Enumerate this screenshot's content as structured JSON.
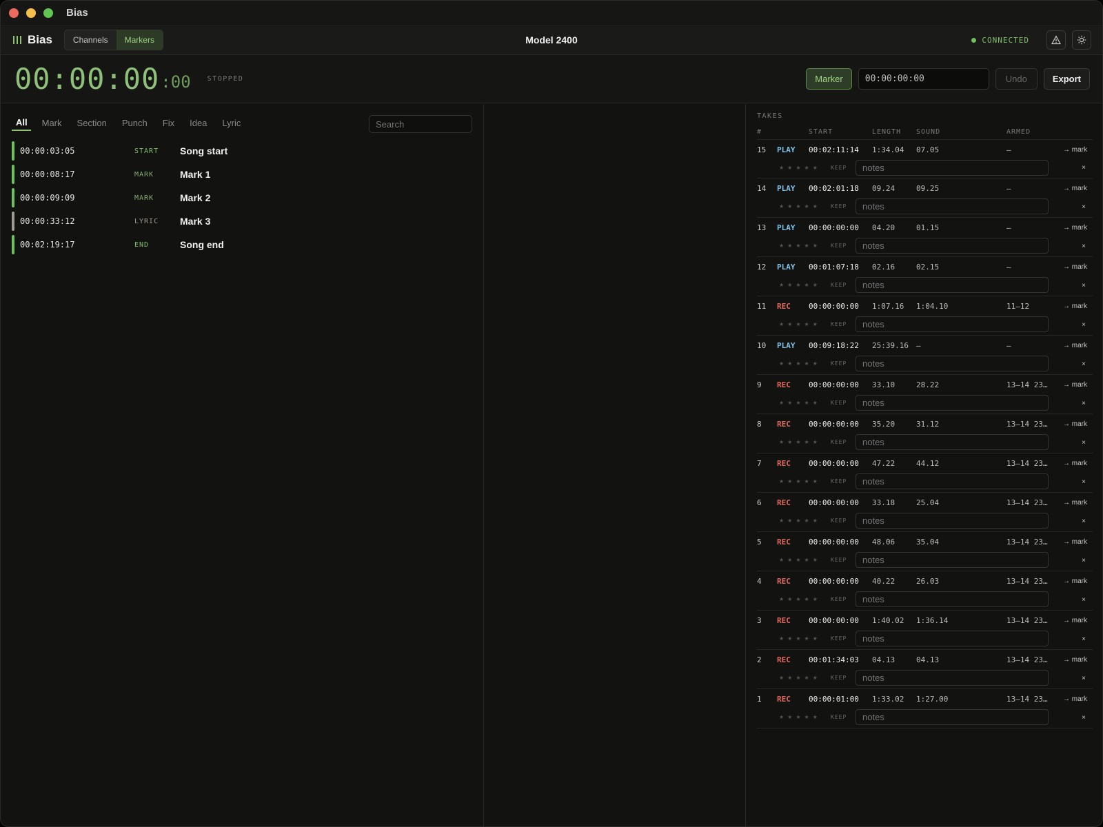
{
  "window": {
    "title": "Bias"
  },
  "app": {
    "logo": "Bias",
    "views": [
      "Channels",
      "Markers"
    ],
    "active_view": "Markers",
    "model": "Model 2400",
    "status": "CONNECTED",
    "icons": [
      "warning-icon",
      "brightness-icon"
    ]
  },
  "transport": {
    "timecode": "00:00:00",
    "frames": ":00",
    "state": "STOPPED",
    "marker_button": "Marker",
    "timecode_input": "00:00:00:00",
    "undo": "Undo",
    "export": "Export"
  },
  "filters": {
    "items": [
      "All",
      "Mark",
      "Section",
      "Punch",
      "Fix",
      "Idea",
      "Lyric"
    ],
    "active": "All",
    "search_placeholder": "Search"
  },
  "markers": [
    {
      "time": "00:00:03:05",
      "type": "START",
      "label": "Song start",
      "color": "#6dc25a",
      "type_color": "#7fbf6a"
    },
    {
      "time": "00:00:08:17",
      "type": "MARK",
      "label": "Mark 1",
      "color": "#6dc25a",
      "type_color": "#8aa870"
    },
    {
      "time": "00:00:09:09",
      "type": "MARK",
      "label": "Mark 2",
      "color": "#6dc25a",
      "type_color": "#8aa870"
    },
    {
      "time": "00:00:33:12",
      "type": "LYRIC",
      "label": "Mark 3",
      "color": "#a09a92",
      "type_color": "#a09a92"
    },
    {
      "time": "00:02:19:17",
      "type": "END",
      "label": "Song end",
      "color": "#6dc25a",
      "type_color": "#7fbf6a"
    }
  ],
  "takes": {
    "title": "TAKES",
    "columns": [
      "#",
      "START",
      "LENGTH",
      "SOUND",
      "ARMED"
    ],
    "keep_label": "KEEP",
    "notes_placeholder": "notes",
    "mark_label": "→ mark",
    "close_label": "×",
    "rows": [
      {
        "num": "15",
        "kind": "PLAY",
        "start": "00:02:11:14",
        "length": "1:34.04",
        "sound": "07.05",
        "armed": "—"
      },
      {
        "num": "14",
        "kind": "PLAY",
        "start": "00:02:01:18",
        "length": "09.24",
        "sound": "09.25",
        "armed": "—"
      },
      {
        "num": "13",
        "kind": "PLAY",
        "start": "00:00:00:00",
        "length": "04.20",
        "sound": "01.15",
        "armed": "—"
      },
      {
        "num": "12",
        "kind": "PLAY",
        "start": "00:01:07:18",
        "length": "02.16",
        "sound": "02.15",
        "armed": "—"
      },
      {
        "num": "11",
        "kind": "REC",
        "start": "00:00:00:00",
        "length": "1:07.16",
        "sound": "1:04.10",
        "armed": "11–12"
      },
      {
        "num": "10",
        "kind": "PLAY",
        "start": "00:09:18:22",
        "length": "25:39.16",
        "sound": "—",
        "armed": "—"
      },
      {
        "num": "9",
        "kind": "REC",
        "start": "00:00:00:00",
        "length": "33.10",
        "sound": "28.22",
        "armed": "13–14 23…"
      },
      {
        "num": "8",
        "kind": "REC",
        "start": "00:00:00:00",
        "length": "35.20",
        "sound": "31.12",
        "armed": "13–14 23…"
      },
      {
        "num": "7",
        "kind": "REC",
        "start": "00:00:00:00",
        "length": "47.22",
        "sound": "44.12",
        "armed": "13–14 23…"
      },
      {
        "num": "6",
        "kind": "REC",
        "start": "00:00:00:00",
        "length": "33.18",
        "sound": "25.04",
        "armed": "13–14 23…"
      },
      {
        "num": "5",
        "kind": "REC",
        "start": "00:00:00:00",
        "length": "48.06",
        "sound": "35.04",
        "armed": "13–14 23…"
      },
      {
        "num": "4",
        "kind": "REC",
        "start": "00:00:00:00",
        "length": "40.22",
        "sound": "26.03",
        "armed": "13–14 23…"
      },
      {
        "num": "3",
        "kind": "REC",
        "start": "00:00:00:00",
        "length": "1:40.02",
        "sound": "1:36.14",
        "armed": "13–14 23…"
      },
      {
        "num": "2",
        "kind": "REC",
        "start": "00:01:34:03",
        "length": "04.13",
        "sound": "04.13",
        "armed": "13–14 23…"
      },
      {
        "num": "1",
        "kind": "REC",
        "start": "00:00:01:00",
        "length": "1:33.02",
        "sound": "1:27.00",
        "armed": "13–14 23…"
      }
    ]
  }
}
